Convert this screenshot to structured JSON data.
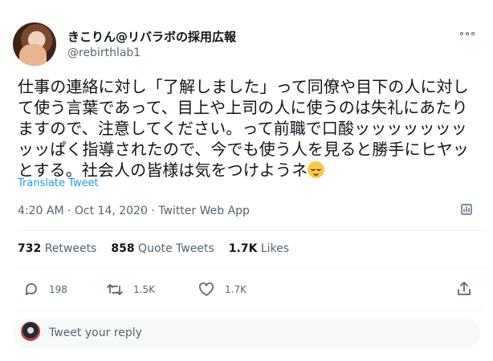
{
  "user": {
    "name": "きこりん@リバラボの採用広報",
    "handle": "@rebirthlab1"
  },
  "tweet": {
    "text_before_emoji": "仕事の連絡に対し「了解しました」って同僚や目下の人に対して使う言葉であって、目上や上司の人に使うのは失礼にあたりますので、注意してください。って前職で口酸ッッッッッッッッッぱく指導されたので、今でも使う人を見ると勝手にヒヤッとする。社会人の皆様は気をつけようネ",
    "emoji": "relieved-face",
    "translate_label": "Translate Tweet",
    "timestamp": "4:20 AM · Oct 14, 2020 · Twitter Web App"
  },
  "stats": {
    "retweets_count": "732",
    "retweets_label": "Retweets",
    "quote_tweets_count": "858",
    "quote_tweets_label": "Quote Tweets",
    "likes_count": "1.7K",
    "likes_label": "Likes"
  },
  "actions": {
    "reply_count": "198",
    "retweet_count": "1.5K",
    "like_count": "1.7K"
  },
  "reply_box": {
    "placeholder": "Tweet your reply"
  },
  "colors": {
    "accent": "#1d9bf0",
    "secondary_text": "#536471",
    "divider": "#eff3f4"
  },
  "icons": [
    "more-icon",
    "analytics-icon",
    "reply-icon",
    "retweet-icon",
    "like-icon",
    "share-icon"
  ]
}
